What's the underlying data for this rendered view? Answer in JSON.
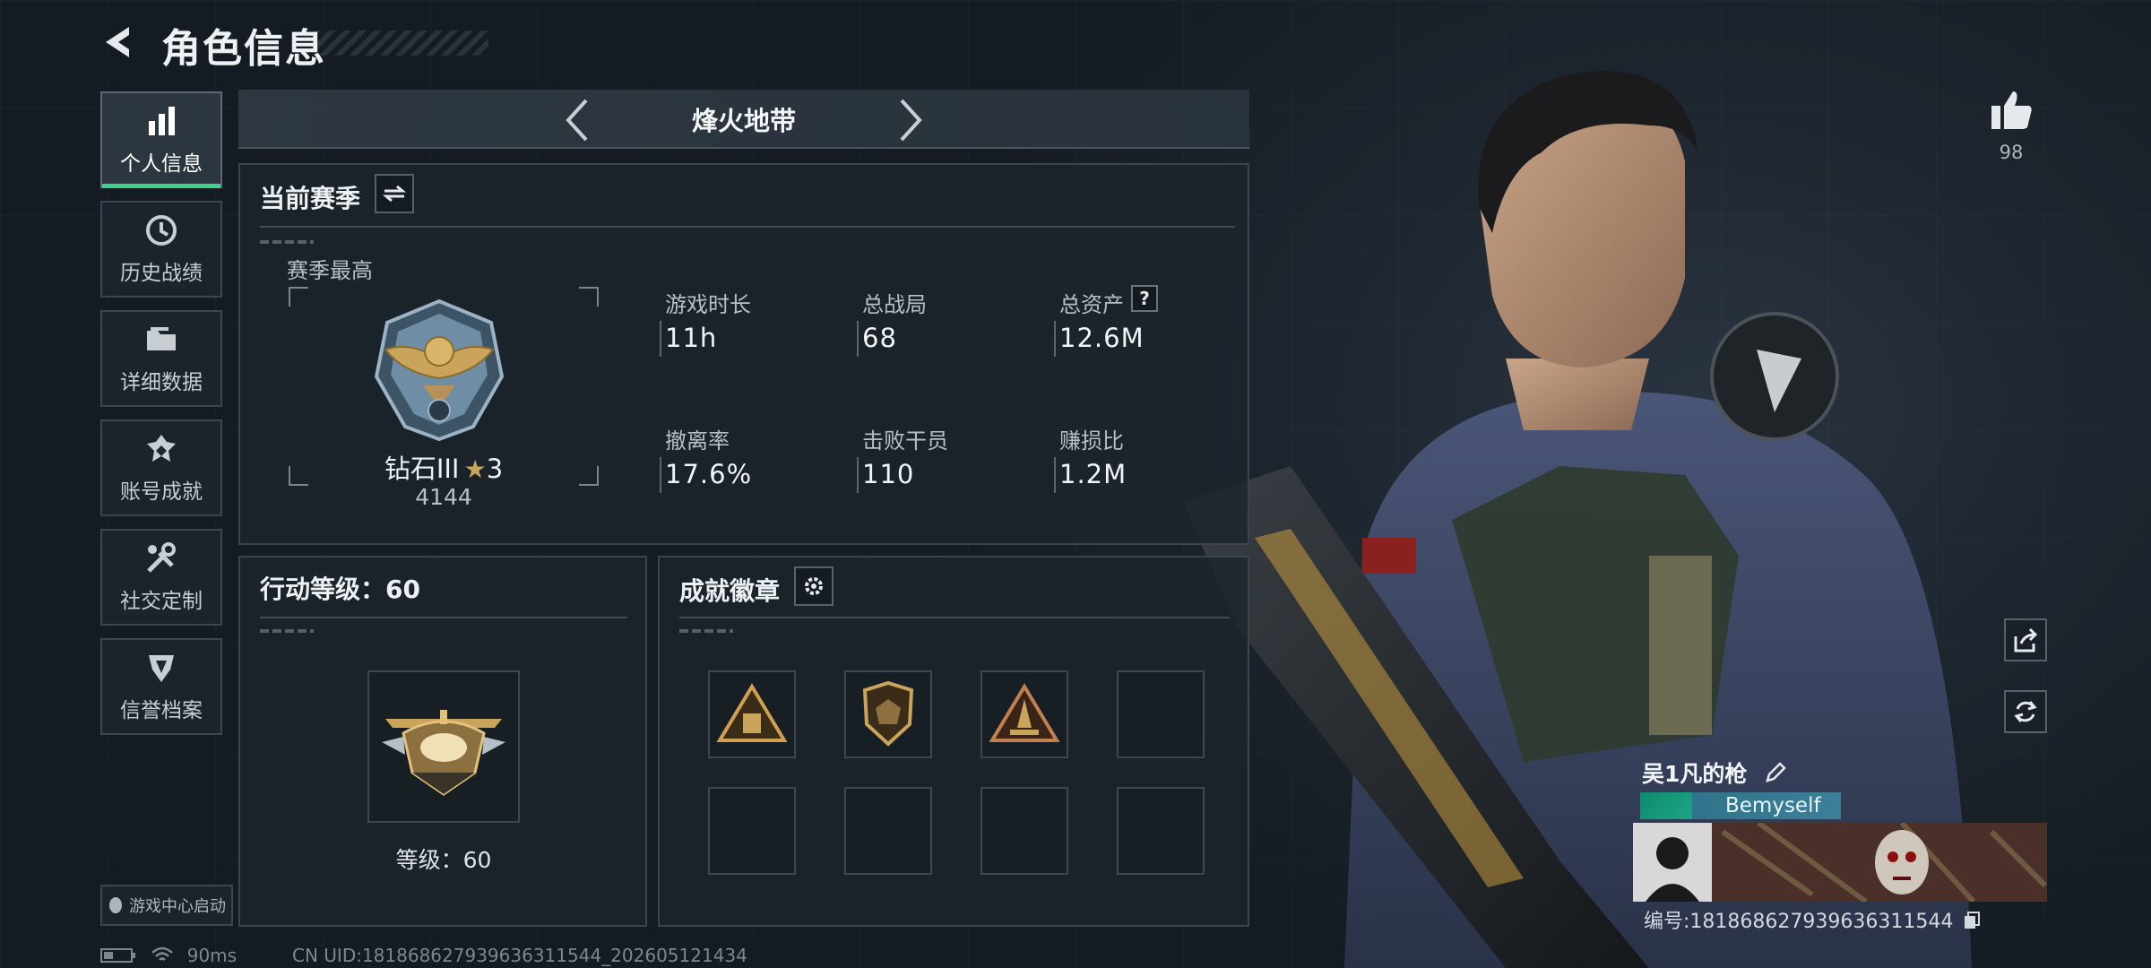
{
  "header": {
    "title": "角色信息"
  },
  "nav": [
    {
      "label": "个人信息",
      "icon": "bar-chart-icon",
      "active": true
    },
    {
      "label": "历史战绩",
      "icon": "history-clock-icon",
      "active": false
    },
    {
      "label": "详细数据",
      "icon": "folder-icon",
      "active": false
    },
    {
      "label": "账号成就",
      "icon": "achievement-icon",
      "active": false
    },
    {
      "label": "社交定制",
      "icon": "wrench-icon",
      "active": false
    },
    {
      "label": "信誉档案",
      "icon": "shield-icon",
      "active": false
    }
  ],
  "launch_button": {
    "label": "游戏中心启动"
  },
  "mode": {
    "name": "烽火地带"
  },
  "season": {
    "title": "当前赛季",
    "best_label": "赛季最高",
    "rank": {
      "name": "钻石III",
      "stars": "3",
      "score": "4144"
    },
    "stats": [
      {
        "label": "游戏时长",
        "value": "11h"
      },
      {
        "label": "总战局",
        "value": "68"
      },
      {
        "label": "总资产",
        "value": "12.6M",
        "help": "?"
      },
      {
        "label": "撤离率",
        "value": "17.6%"
      },
      {
        "label": "击败干员",
        "value": "110"
      },
      {
        "label": "赚损比",
        "value": "1.2M"
      }
    ]
  },
  "level": {
    "title": "行动等级：60",
    "text": "等级：60"
  },
  "badges": {
    "title": "成就徽章",
    "filled": 3,
    "total": 8
  },
  "likes": {
    "count": "98"
  },
  "player": {
    "name": "吴1凡的枪",
    "tag": "Bemyself",
    "id_text": "编号:181868627939636311544"
  },
  "footer": {
    "ping": "90ms",
    "uid": "CN UID:181868627939636311544_202605121434"
  },
  "colors": {
    "accent": "#3fd08a",
    "gold": "#c9a45a",
    "tag": "#2b6f86"
  }
}
